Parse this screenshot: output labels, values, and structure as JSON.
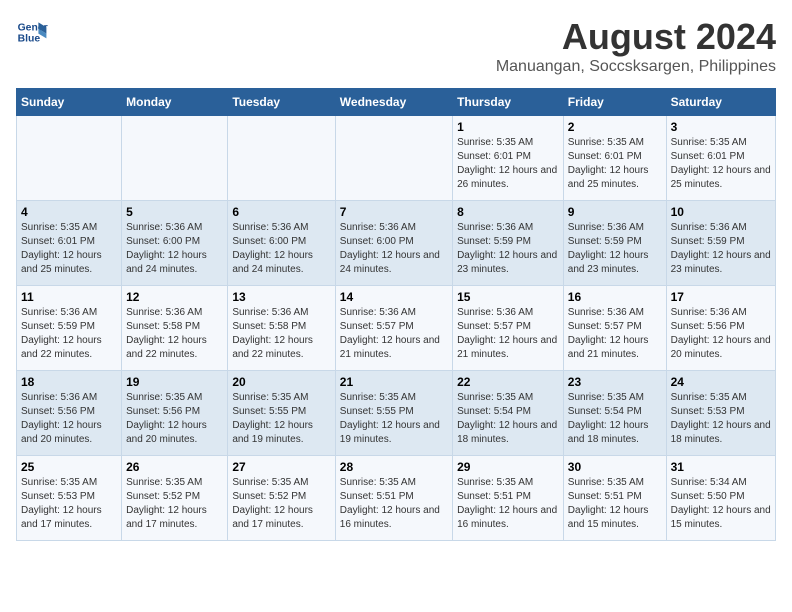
{
  "header": {
    "logo_line1": "General",
    "logo_line2": "Blue",
    "month_year": "August 2024",
    "location": "Manuangan, Soccsksargen, Philippines"
  },
  "days_of_week": [
    "Sunday",
    "Monday",
    "Tuesday",
    "Wednesday",
    "Thursday",
    "Friday",
    "Saturday"
  ],
  "weeks": [
    [
      {
        "day": "",
        "info": ""
      },
      {
        "day": "",
        "info": ""
      },
      {
        "day": "",
        "info": ""
      },
      {
        "day": "",
        "info": ""
      },
      {
        "day": "1",
        "info": "Sunrise: 5:35 AM\nSunset: 6:01 PM\nDaylight: 12 hours and 26 minutes."
      },
      {
        "day": "2",
        "info": "Sunrise: 5:35 AM\nSunset: 6:01 PM\nDaylight: 12 hours and 25 minutes."
      },
      {
        "day": "3",
        "info": "Sunrise: 5:35 AM\nSunset: 6:01 PM\nDaylight: 12 hours and 25 minutes."
      }
    ],
    [
      {
        "day": "4",
        "info": "Sunrise: 5:35 AM\nSunset: 6:01 PM\nDaylight: 12 hours and 25 minutes."
      },
      {
        "day": "5",
        "info": "Sunrise: 5:36 AM\nSunset: 6:00 PM\nDaylight: 12 hours and 24 minutes."
      },
      {
        "day": "6",
        "info": "Sunrise: 5:36 AM\nSunset: 6:00 PM\nDaylight: 12 hours and 24 minutes."
      },
      {
        "day": "7",
        "info": "Sunrise: 5:36 AM\nSunset: 6:00 PM\nDaylight: 12 hours and 24 minutes."
      },
      {
        "day": "8",
        "info": "Sunrise: 5:36 AM\nSunset: 5:59 PM\nDaylight: 12 hours and 23 minutes."
      },
      {
        "day": "9",
        "info": "Sunrise: 5:36 AM\nSunset: 5:59 PM\nDaylight: 12 hours and 23 minutes."
      },
      {
        "day": "10",
        "info": "Sunrise: 5:36 AM\nSunset: 5:59 PM\nDaylight: 12 hours and 23 minutes."
      }
    ],
    [
      {
        "day": "11",
        "info": "Sunrise: 5:36 AM\nSunset: 5:59 PM\nDaylight: 12 hours and 22 minutes."
      },
      {
        "day": "12",
        "info": "Sunrise: 5:36 AM\nSunset: 5:58 PM\nDaylight: 12 hours and 22 minutes."
      },
      {
        "day": "13",
        "info": "Sunrise: 5:36 AM\nSunset: 5:58 PM\nDaylight: 12 hours and 22 minutes."
      },
      {
        "day": "14",
        "info": "Sunrise: 5:36 AM\nSunset: 5:57 PM\nDaylight: 12 hours and 21 minutes."
      },
      {
        "day": "15",
        "info": "Sunrise: 5:36 AM\nSunset: 5:57 PM\nDaylight: 12 hours and 21 minutes."
      },
      {
        "day": "16",
        "info": "Sunrise: 5:36 AM\nSunset: 5:57 PM\nDaylight: 12 hours and 21 minutes."
      },
      {
        "day": "17",
        "info": "Sunrise: 5:36 AM\nSunset: 5:56 PM\nDaylight: 12 hours and 20 minutes."
      }
    ],
    [
      {
        "day": "18",
        "info": "Sunrise: 5:36 AM\nSunset: 5:56 PM\nDaylight: 12 hours and 20 minutes."
      },
      {
        "day": "19",
        "info": "Sunrise: 5:35 AM\nSunset: 5:56 PM\nDaylight: 12 hours and 20 minutes."
      },
      {
        "day": "20",
        "info": "Sunrise: 5:35 AM\nSunset: 5:55 PM\nDaylight: 12 hours and 19 minutes."
      },
      {
        "day": "21",
        "info": "Sunrise: 5:35 AM\nSunset: 5:55 PM\nDaylight: 12 hours and 19 minutes."
      },
      {
        "day": "22",
        "info": "Sunrise: 5:35 AM\nSunset: 5:54 PM\nDaylight: 12 hours and 18 minutes."
      },
      {
        "day": "23",
        "info": "Sunrise: 5:35 AM\nSunset: 5:54 PM\nDaylight: 12 hours and 18 minutes."
      },
      {
        "day": "24",
        "info": "Sunrise: 5:35 AM\nSunset: 5:53 PM\nDaylight: 12 hours and 18 minutes."
      }
    ],
    [
      {
        "day": "25",
        "info": "Sunrise: 5:35 AM\nSunset: 5:53 PM\nDaylight: 12 hours and 17 minutes."
      },
      {
        "day": "26",
        "info": "Sunrise: 5:35 AM\nSunset: 5:52 PM\nDaylight: 12 hours and 17 minutes."
      },
      {
        "day": "27",
        "info": "Sunrise: 5:35 AM\nSunset: 5:52 PM\nDaylight: 12 hours and 17 minutes."
      },
      {
        "day": "28",
        "info": "Sunrise: 5:35 AM\nSunset: 5:51 PM\nDaylight: 12 hours and 16 minutes."
      },
      {
        "day": "29",
        "info": "Sunrise: 5:35 AM\nSunset: 5:51 PM\nDaylight: 12 hours and 16 minutes."
      },
      {
        "day": "30",
        "info": "Sunrise: 5:35 AM\nSunset: 5:51 PM\nDaylight: 12 hours and 15 minutes."
      },
      {
        "day": "31",
        "info": "Sunrise: 5:34 AM\nSunset: 5:50 PM\nDaylight: 12 hours and 15 minutes."
      }
    ]
  ]
}
